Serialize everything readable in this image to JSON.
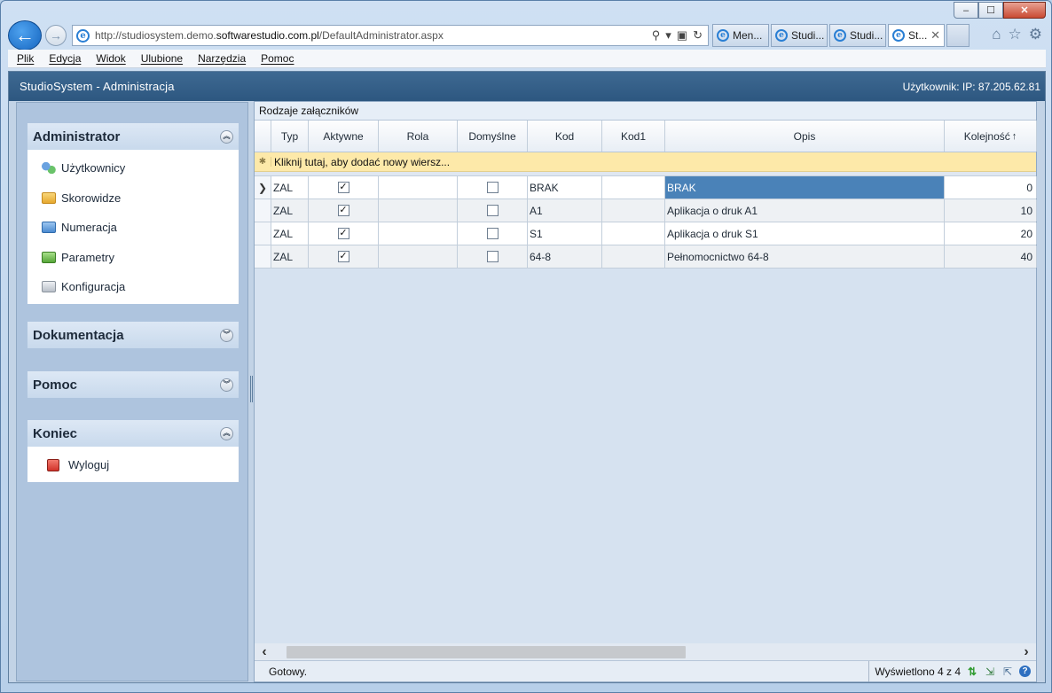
{
  "browser": {
    "address": {
      "prefix": "http://studiosystem.demo.",
      "domain": "softwarestudio.com.pl",
      "suffix": "/DefaultAdministrator.aspx"
    },
    "tabs": [
      {
        "label": "Men..."
      },
      {
        "label": "Studi..."
      },
      {
        "label": "Studi..."
      },
      {
        "label": "St...",
        "active": true
      }
    ],
    "window_controls": {
      "minimize": "‒",
      "maximize": "☐",
      "close": "✕"
    },
    "menu": [
      "Plik",
      "Edycja",
      "Widok",
      "Ulubione",
      "Narzędzia",
      "Pomoc"
    ]
  },
  "app": {
    "title": "StudioSystem - Administracja",
    "user_info": "Użytkownik: IP: 87.205.62.81"
  },
  "sidebar": {
    "panels": [
      {
        "title": "Administrator",
        "expanded": true,
        "items": [
          {
            "label": "Użytkownicy",
            "icon": "users-icon"
          },
          {
            "label": "Skorowidze",
            "icon": "folder-yellow-icon"
          },
          {
            "label": "Numeracja",
            "icon": "folder-blue-icon"
          },
          {
            "label": "Parametry",
            "icon": "folder-green-icon"
          },
          {
            "label": "Konfiguracja",
            "icon": "folder-gray-icon"
          }
        ]
      },
      {
        "title": "Dokumentacja",
        "expanded": false
      },
      {
        "title": "Pomoc",
        "expanded": false
      },
      {
        "title": "Koniec",
        "expanded": true,
        "items": [
          {
            "label": "Wyloguj",
            "icon": "logout-icon"
          }
        ]
      }
    ]
  },
  "grid": {
    "title": "Rodzaje załączników",
    "columns": [
      "Typ",
      "Aktywne",
      "Rola",
      "Domyślne",
      "Kod",
      "Kod1",
      "Opis",
      "Kolejność"
    ],
    "sort_indicator": "↑",
    "new_row_text": "Kliknij tutaj, aby dodać nowy wiersz...",
    "rows": [
      {
        "typ": "ZAL",
        "aktywne": true,
        "rola": "",
        "domyslne": false,
        "kod": "BRAK",
        "kod1": "",
        "opis": "BRAK",
        "kolejnosc": "0",
        "current": true
      },
      {
        "typ": "ZAL",
        "aktywne": true,
        "rola": "",
        "domyslne": false,
        "kod": "A1",
        "kod1": "",
        "opis": "Aplikacja o druk A1",
        "kolejnosc": "10"
      },
      {
        "typ": "ZAL",
        "aktywne": true,
        "rola": "",
        "domyslne": false,
        "kod": "S1",
        "kod1": "",
        "opis": "Aplikacja o druk S1",
        "kolejnosc": "20"
      },
      {
        "typ": "ZAL",
        "aktywne": true,
        "rola": "",
        "domyslne": false,
        "kod": "64-8",
        "kod1": "",
        "opis": "Pełnomocnictwo 64-8",
        "kolejnosc": "40"
      }
    ],
    "status_left": "Gotowy.",
    "status_right": "Wyświetlono 4 z 4"
  },
  "colors": {
    "header_bg": "#2d5780",
    "selected_cell": "#4a82b8",
    "new_row_bg": "#fde9a9"
  }
}
